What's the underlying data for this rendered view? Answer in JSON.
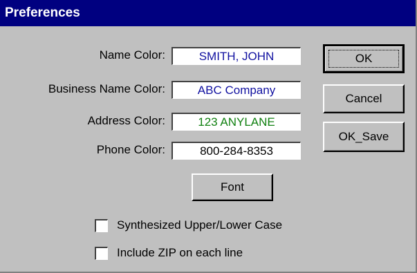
{
  "window": {
    "title": "Preferences"
  },
  "fields": {
    "name": {
      "label": "Name Color:",
      "value": "SMITH, JOHN",
      "color": "#1010a0"
    },
    "business": {
      "label": "Business Name Color:",
      "value": "ABC Company",
      "color": "#1010a0"
    },
    "address": {
      "label": "Address Color:",
      "value": "123 ANYLANE",
      "color": "#108010"
    },
    "phone": {
      "label": "Phone Color:",
      "value": "800-284-8353",
      "color": "#000000"
    }
  },
  "buttons": {
    "ok": "OK",
    "cancel": "Cancel",
    "ok_save": "OK_Save",
    "font": "Font"
  },
  "options": {
    "synthesized_case": {
      "label": "Synthesized Upper/Lower Case",
      "checked": false
    },
    "include_zip": {
      "label": "Include ZIP on each line",
      "checked": false
    }
  }
}
